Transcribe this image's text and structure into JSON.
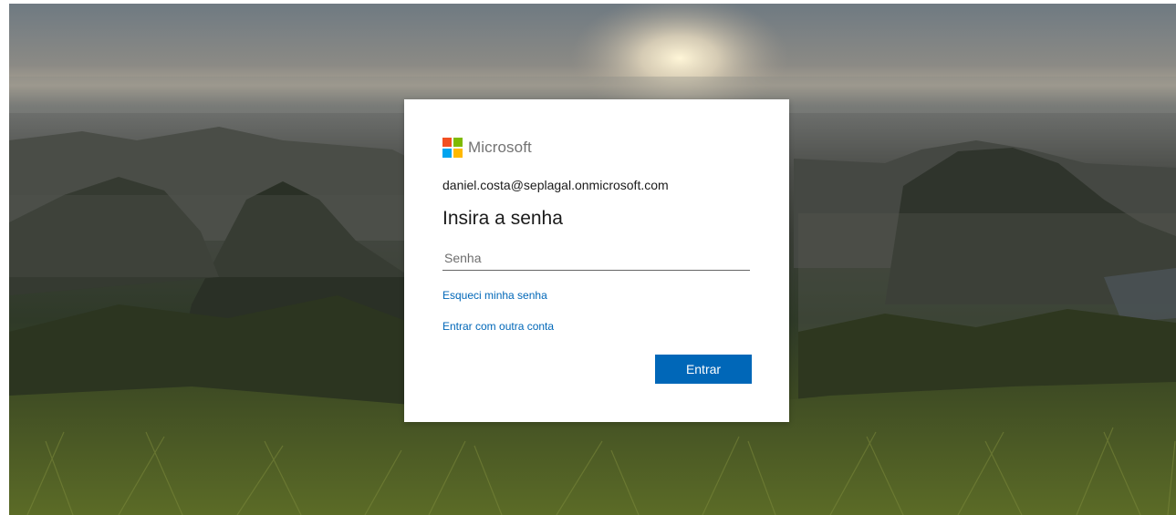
{
  "brand": {
    "name": "Microsoft",
    "logo_colors": [
      "#f25022",
      "#7fba00",
      "#00a4ef",
      "#ffb900"
    ]
  },
  "signin": {
    "account": "daniel.costa@seplagal.onmicrosoft.com",
    "title": "Insira a senha",
    "password_placeholder": "Senha",
    "password_value": "",
    "forgot_link": "Esqueci minha senha",
    "other_account_link": "Entrar com outra conta",
    "submit_label": "Entrar"
  },
  "theme": {
    "accent": "#0067b8"
  }
}
